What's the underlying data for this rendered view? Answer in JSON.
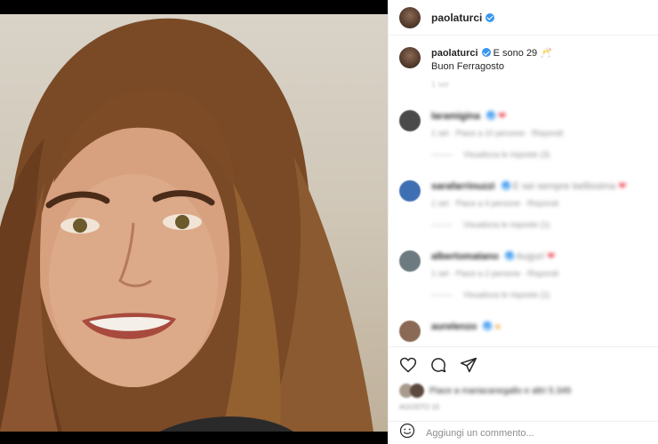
{
  "post": {
    "username": "paolaturci",
    "caption_text": "E sono 29",
    "caption_line2": "Buon Ferragosto",
    "caption_emoji": "🥂",
    "time": "1 set"
  },
  "comments": [
    {
      "username": "laramigina",
      "text": "",
      "meta": "1 set  ·  Piace a 10 persone  ·  Rispondi",
      "replies": "Visualizza le risposte (3)",
      "avatar_color": "#4a4a4a"
    },
    {
      "username": "sarafarrinuzzi",
      "text": "E sei sempre bellissima",
      "meta": "1 set  ·  Piace a 4 persone  ·  Rispondi",
      "replies": "Visualizza le risposte (1)",
      "avatar_color": "#3f6fb3"
    },
    {
      "username": "albertomatano",
      "text": "Auguri",
      "meta": "1 set  ·  Piace a 2 persone  ·  Rispondi",
      "replies": "Visualizza le risposte (1)",
      "avatar_color": "#6d7a80"
    },
    {
      "username": "aurelenzo",
      "text": "",
      "meta": "",
      "replies": "",
      "avatar_color": "#8a6a55"
    }
  ],
  "likes": {
    "text": "Piace a mariacanegallo e altri 5.349"
  },
  "date": "AGOSTO 15",
  "add_comment": {
    "placeholder": "Aggiungi un commento..."
  },
  "icons": {
    "like": "heart-outline-icon",
    "comment": "comment-bubble-icon",
    "share": "paper-plane-icon",
    "emoji": "smiley-icon"
  },
  "colors": {
    "verified": "#3897f0",
    "heart": "#ed4956"
  }
}
